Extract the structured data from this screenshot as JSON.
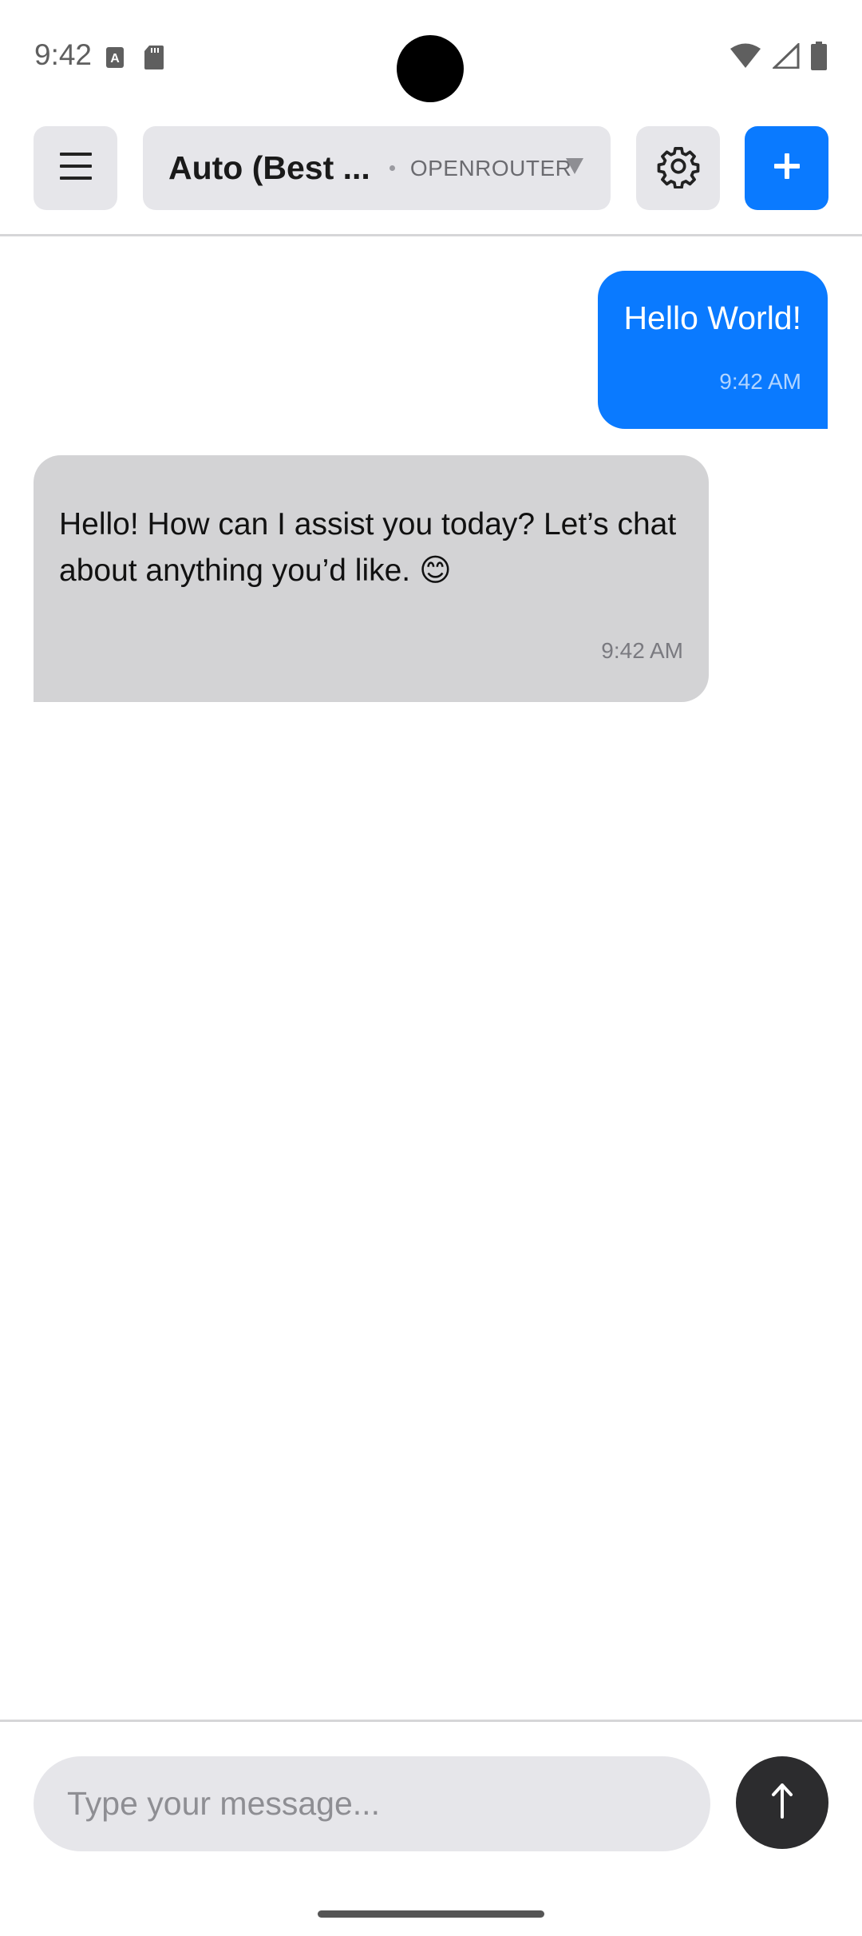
{
  "status_bar": {
    "time": "9:42",
    "left_icons": [
      "text-a-icon",
      "sd-card-icon"
    ],
    "right_icons": [
      "wifi-icon",
      "cell-signal-icon",
      "battery-icon"
    ]
  },
  "header": {
    "menu_icon": "hamburger-menu-icon",
    "model_name": "Auto (Best ...",
    "model_provider": "OPENROUTER",
    "settings_icon": "gear-icon",
    "new_chat_icon": "plus-icon"
  },
  "messages": [
    {
      "role": "user",
      "text": "Hello World!",
      "time": "9:42 AM"
    },
    {
      "role": "assistant",
      "text": "Hello! How can I assist you today? Let’s chat about anything you’d like. 😊",
      "time": "9:42 AM"
    }
  ],
  "composer": {
    "placeholder": "Type your message...",
    "value": "",
    "send_icon": "arrow-up-icon"
  },
  "colors": {
    "accent": "#0a7aff",
    "user_bubble": "#0a7aff",
    "assistant_bubble": "#d3d3d5",
    "send_button": "#2c2c2e"
  }
}
